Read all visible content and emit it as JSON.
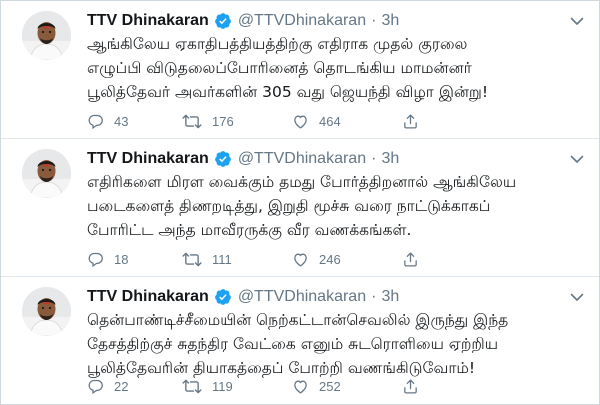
{
  "colors": {
    "verified": "#1da1f2",
    "icon": "#657786",
    "text": "#14171a",
    "muted": "#657786"
  },
  "icons": {
    "verified": "verified-badge-icon",
    "reply": "reply-icon",
    "retweet": "retweet-icon",
    "like": "heart-icon",
    "share": "share-icon",
    "caret": "chevron-down-icon"
  },
  "tweets": [
    {
      "name": "TTV Dhinakaran",
      "handle": "@TTVDhinakaran",
      "dot": "·",
      "time": "3h",
      "lines": [
        "ஆங்கிலேய ஏகாதிபத்தியத்திற்கு எதிராக முதல் குரலை",
        "எழுப்பி விடுதலைப்போரினைத் தொடங்கிய மாமன்னர்",
        "பூலித்தேவர் அவர்களின் 305 வது ஜெயந்தி விழா இன்று!"
      ],
      "replies": "43",
      "retweets": "176",
      "likes": "464"
    },
    {
      "name": "TTV Dhinakaran",
      "handle": "@TTVDhinakaran",
      "dot": "·",
      "time": "3h",
      "lines": [
        "எதிரிகளை மிரள வைக்கும் தமது போர்த்திறனால் ஆங்கிலேய",
        "படைகளைத் திணறடித்து,  இறுதி மூச்சு வரை நாட்டுக்காகப்",
        "போரிட்ட அந்த மாவீரருக்கு வீர வணக்கங்கள்."
      ],
      "replies": "18",
      "retweets": "111",
      "likes": "246"
    },
    {
      "name": "TTV Dhinakaran",
      "handle": "@TTVDhinakaran",
      "dot": "·",
      "time": "3h",
      "lines": [
        "தென்பாண்டிச்சீமையின் நெற்கட்டான்செவலில் இருந்து இந்த",
        "தேசத்திற்குச் சுதந்திர வேட்கை எனும் சுடரொளியை ஏற்றிய",
        "பூலித்தேவரின் தியாகத்தைப் போற்றி வணங்கிடுவோம்!"
      ],
      "replies": "22",
      "retweets": "119",
      "likes": "252"
    }
  ]
}
